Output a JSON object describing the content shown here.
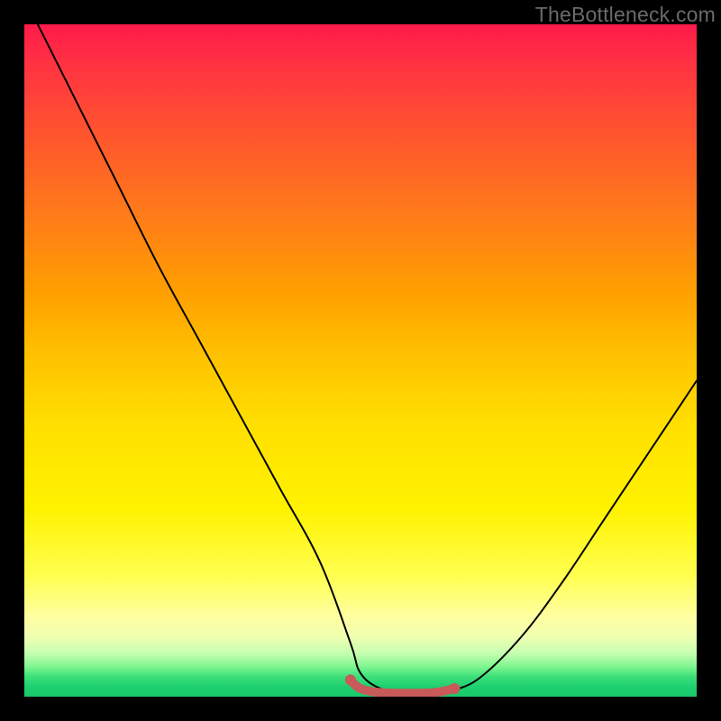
{
  "watermark": "TheBottleneck.com",
  "colors": {
    "frame_border": "#000000",
    "curve_stroke": "#000000",
    "optimum_stroke": "#c85a5a",
    "watermark_text": "#6a6a6a"
  },
  "chart_data": {
    "type": "line",
    "title": "",
    "xlabel": "",
    "ylabel": "",
    "xlim": [
      0,
      1
    ],
    "ylim": [
      0,
      1
    ],
    "grid": false,
    "series": [
      {
        "name": "bottleneck_curve",
        "x": [
          0.02,
          0.08,
          0.14,
          0.2,
          0.26,
          0.32,
          0.38,
          0.44,
          0.485,
          0.5,
          0.53,
          0.57,
          0.61,
          0.64,
          0.68,
          0.74,
          0.8,
          0.86,
          0.92,
          0.98,
          1.0
        ],
        "y": [
          1.0,
          0.88,
          0.76,
          0.64,
          0.53,
          0.42,
          0.31,
          0.2,
          0.08,
          0.035,
          0.012,
          0.005,
          0.005,
          0.01,
          0.03,
          0.09,
          0.17,
          0.26,
          0.35,
          0.44,
          0.47
        ]
      },
      {
        "name": "optimum_zone",
        "x": [
          0.485,
          0.5,
          0.53,
          0.57,
          0.61,
          0.64
        ],
        "y": [
          0.025,
          0.012,
          0.006,
          0.005,
          0.006,
          0.012
        ]
      }
    ],
    "annotations": []
  }
}
